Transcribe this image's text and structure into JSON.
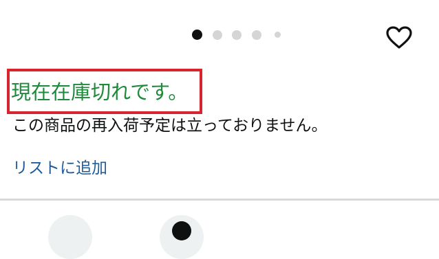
{
  "carousel": {
    "total_images": 5,
    "active_index": 1
  },
  "wishlist": {
    "icon": "heart-outline-icon"
  },
  "availability": {
    "status_text": "現在在庫切れです。",
    "note_text": "この商品の再入荷予定は立っておりません。",
    "status_color": "#1f8a3c",
    "highlight_color": "#d9232d"
  },
  "actions": {
    "add_to_list_label": "リストに追加",
    "link_color": "#1f5c99"
  },
  "bottom_buttons": [
    {
      "icon": "circle-button-icon"
    },
    {
      "icon": "circle-button-icon"
    }
  ]
}
